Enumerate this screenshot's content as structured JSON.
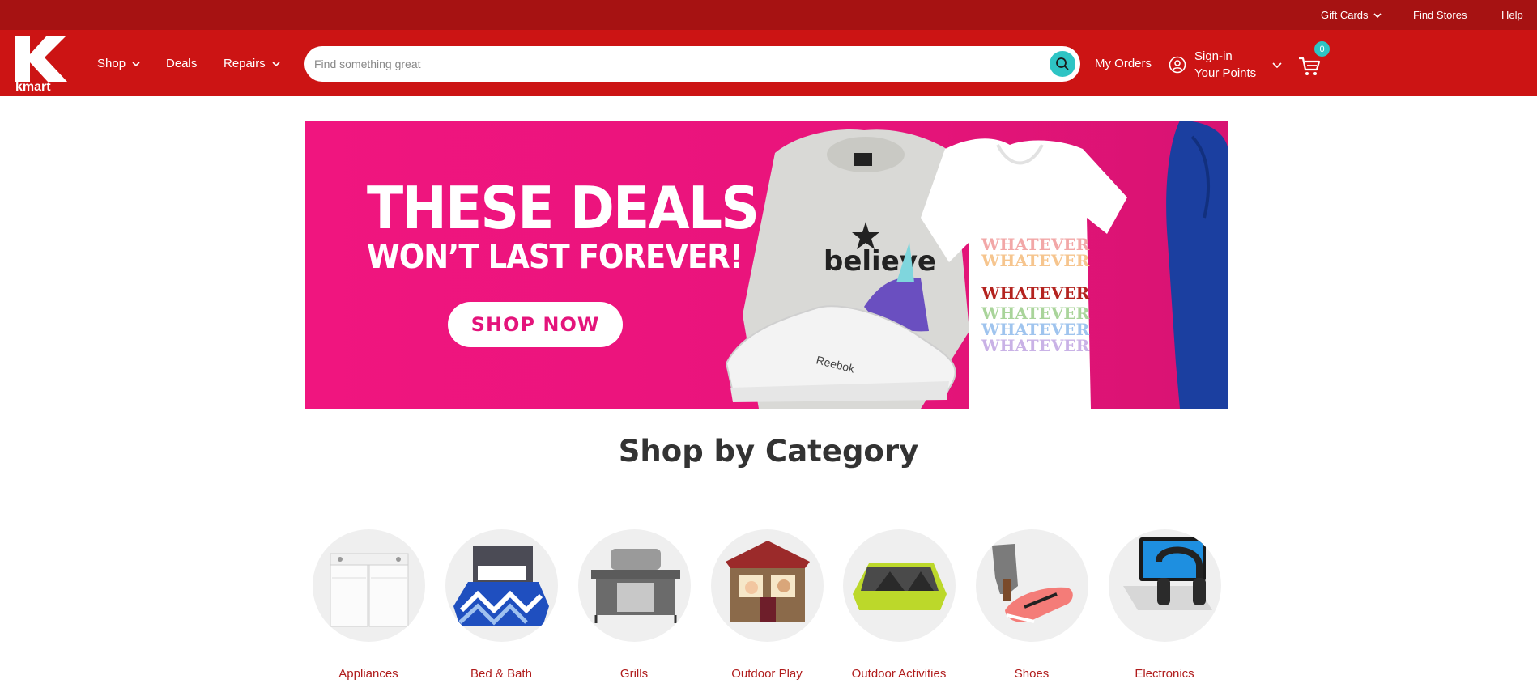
{
  "utility": {
    "gift_cards": "Gift Cards",
    "find_stores": "Find Stores",
    "help": "Help"
  },
  "header": {
    "logo_text": "kmart",
    "nav": {
      "shop": "Shop",
      "deals": "Deals",
      "repairs": "Repairs"
    },
    "search": {
      "placeholder": "Find something great"
    },
    "my_orders": "My Orders",
    "signin": {
      "line1": "Sign-in",
      "line2": "Your Points"
    },
    "cart_count": "0"
  },
  "hero": {
    "line1": "THESE DEALS",
    "line2": "WON’T LAST FOREVER!",
    "cta": "SHOP NOW",
    "product_prints": {
      "sneaker": "Reebok",
      "sweatshirt": "believe",
      "tee": "WHATEVER"
    }
  },
  "categories": {
    "title": "Shop by Category",
    "items": [
      {
        "label": "Appliances"
      },
      {
        "label": "Bed & Bath"
      },
      {
        "label": "Grills"
      },
      {
        "label": "Outdoor Play"
      },
      {
        "label": "Outdoor Activities"
      },
      {
        "label": "Shoes"
      },
      {
        "label": "Electronics"
      }
    ]
  },
  "colors": {
    "utility_bar": "#a61212",
    "header": "#cc1414",
    "accent_teal": "#2ec4c4",
    "hero_pink": "#e9147c",
    "category_label": "#b01c1c"
  }
}
